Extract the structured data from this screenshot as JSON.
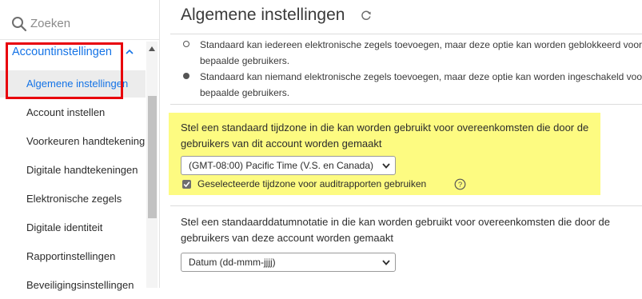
{
  "sidebar": {
    "search_placeholder": "Zoeken",
    "section_label": "Accountinstellingen",
    "items": [
      {
        "label": "Algemene instellingen",
        "active": true
      },
      {
        "label": "Account instellen"
      },
      {
        "label": "Voorkeuren handtekening"
      },
      {
        "label": "Digitale handtekeningen"
      },
      {
        "label": "Elektronische zegels"
      },
      {
        "label": "Digitale identiteit"
      },
      {
        "label": "Rapportinstellingen"
      },
      {
        "label": "Beveiligingsinstellingen"
      }
    ]
  },
  "main": {
    "title": "Algemene instellingen",
    "radio_options": [
      {
        "text": "Standaard kan iedereen elektronische zegels toevoegen, maar deze optie kan worden geblokkeerd voor bepaalde gebruikers.",
        "selected": false
      },
      {
        "text": "Standaard kan niemand elektronische zegels toevoegen, maar deze optie kan worden ingeschakeld voor bepaalde gebruikers.",
        "selected": true
      }
    ],
    "timezone": {
      "description": "Stel een standaard tijdzone in die kan worden gebruikt voor overeenkomsten die door de gebruikers van dit account worden gemaakt",
      "selected": "(GMT-08:00) Pacific Time (V.S. en Canada)",
      "checkbox_label": "Geselecteerde tijdzone voor auditrapporten gebruiken",
      "checkbox_checked": true
    },
    "date_format": {
      "description": "Stel een standaarddatumnotatie in die kan worden gebruikt voor overeenkomsten die door de gebruikers van deze account worden gemaakt",
      "selected": "Datum (dd-mmm-jjjj)"
    }
  },
  "colors": {
    "accent": "#1473e6",
    "highlight": "#fdfb81",
    "annotation_red": "#e8000b"
  }
}
